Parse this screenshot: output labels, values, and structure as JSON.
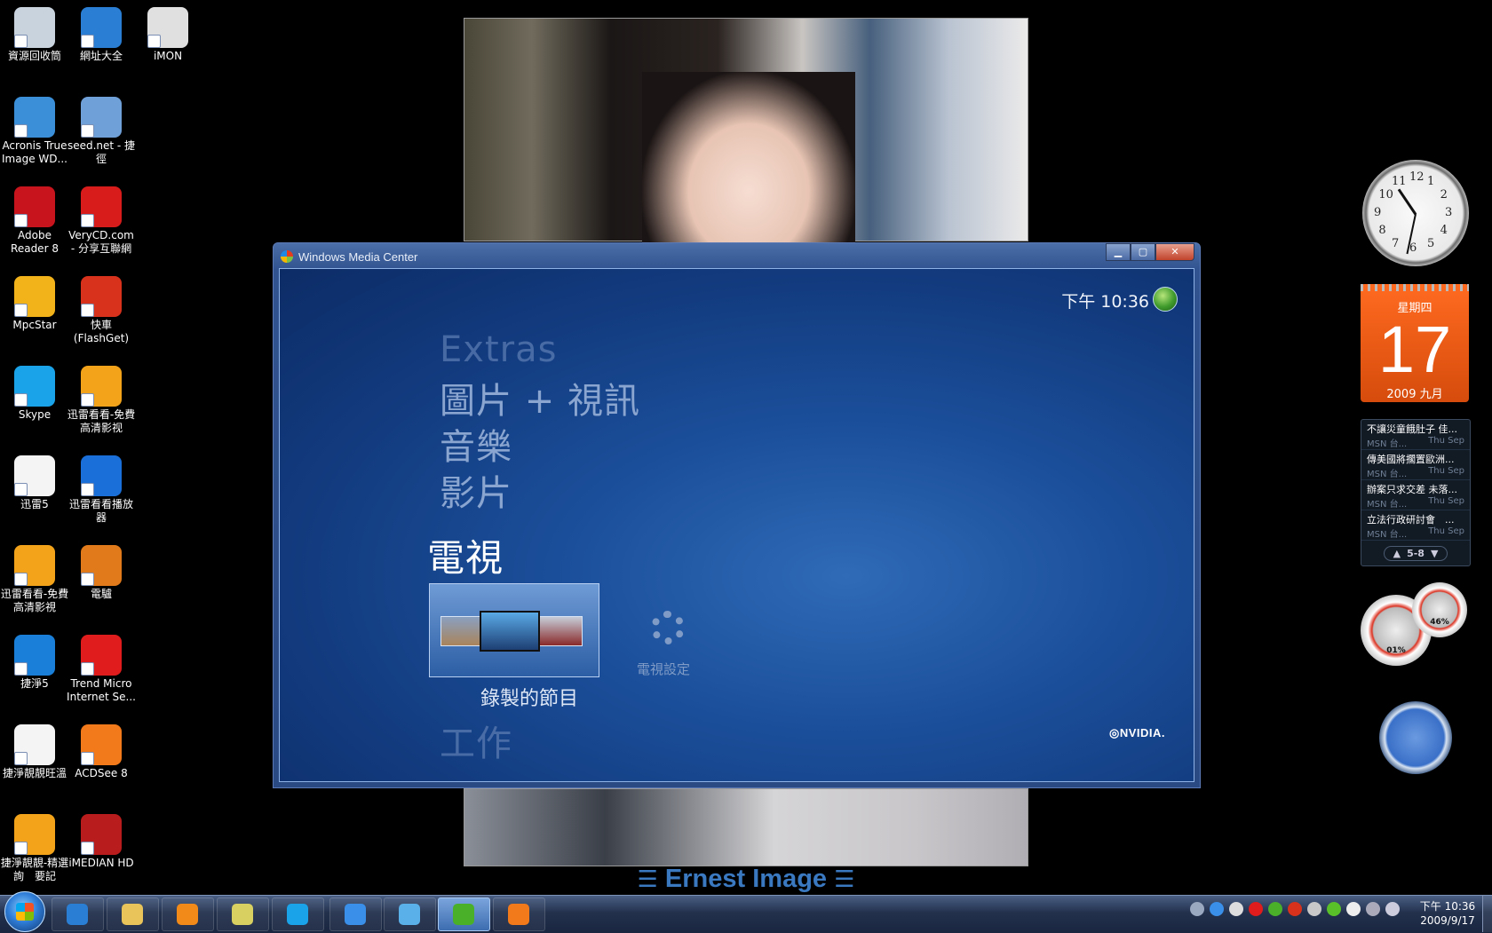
{
  "desktop": {
    "icons": [
      {
        "label": "資源回收筒",
        "name": "recycle-bin-icon",
        "color": "#c9d3de"
      },
      {
        "label": "網址大全",
        "name": "internet-explorer-icon",
        "color": "#2a7fd4"
      },
      {
        "label": "iMON",
        "name": "imon-icon",
        "color": "#e0e0e0"
      },
      {
        "label": "Acronis True Image WD...",
        "name": "acronis-icon",
        "color": "#3a8fd8"
      },
      {
        "label": "seed.net - 捷徑",
        "name": "seed-net-icon",
        "color": "#6fa0d8"
      },
      {
        "label": "Adobe Reader 8",
        "name": "adobe-reader-icon",
        "color": "#c8141c"
      },
      {
        "label": "VeryCD.com - 分享互聯網",
        "name": "verycd-icon",
        "color": "#d81c1c"
      },
      {
        "label": "MpcStar",
        "name": "mpcstar-icon",
        "color": "#f2b21a"
      },
      {
        "label": "快車 (FlashGet)",
        "name": "flashget-icon",
        "color": "#d8321c"
      },
      {
        "label": "Skype",
        "name": "skype-icon",
        "color": "#1aa3e8"
      },
      {
        "label": "迅雷看看-免費高清影视",
        "name": "xunlei-kankan-icon",
        "color": "#f2a31a"
      },
      {
        "label": "迅雷5",
        "name": "xunlei5-doc-icon",
        "color": "#f4f4f4"
      },
      {
        "label": "迅雷看看播放器",
        "name": "xunlei-player-icon",
        "color": "#1a6fd8"
      },
      {
        "label": "迅雷看看-免費高清影視",
        "name": "xunlei-kankan-2-icon",
        "color": "#f2a31a"
      },
      {
        "label": "電驢",
        "name": "emule-icon",
        "color": "#e07a1a"
      },
      {
        "label": "捷淨5",
        "name": "jiejing5-icon",
        "color": "#1a7fd8"
      },
      {
        "label": "Trend Micro Internet Se...",
        "name": "trend-micro-icon",
        "color": "#e01c1c"
      },
      {
        "label": "捷淨靚靚旺溫",
        "name": "jiejing-doc-icon",
        "color": "#f4f4f4"
      },
      {
        "label": "ACDSee 8",
        "name": "acdsee-icon",
        "color": "#f27a1a"
      },
      {
        "label": "捷淨靚靚-精選詢　要記",
        "name": "jiejing-kankan-icon",
        "color": "#f2a31a"
      },
      {
        "label": "iMEDIAN HD",
        "name": "imedian-hd-icon",
        "color": "#b81c1c"
      }
    ]
  },
  "watermark": {
    "text": "Ernest Image",
    "bars": "☰"
  },
  "media_center": {
    "title": "Windows Media Center",
    "time": "下午 10:36",
    "menu": {
      "extras": "Extras",
      "pictures_video": "圖片 + 視訊",
      "music": "音樂",
      "movies": "影片",
      "tv": "電視",
      "tasks": "工作"
    },
    "tiles": {
      "recorded": "錄製的節目",
      "tv_settings": "電視設定"
    },
    "brand": "◎NVIDIA."
  },
  "gadgets": {
    "clock": {
      "numbers": [
        "12",
        "1",
        "2",
        "3",
        "4",
        "5",
        "6",
        "7",
        "8",
        "9",
        "10",
        "11"
      ]
    },
    "calendar": {
      "weekday": "星期四",
      "day": "17",
      "year_month": "2009 九月"
    },
    "feed": {
      "items": [
        {
          "title": "不讓災童餓肚子 佳...",
          "source": "MSN 台...",
          "date": "Thu Sep"
        },
        {
          "title": "傳美國將擱置歐洲...",
          "source": "MSN 台...",
          "date": "Thu Sep"
        },
        {
          "title": "辦案只求交差 未落...",
          "source": "MSN 台...",
          "date": "Thu Sep"
        },
        {
          "title": "立法行政研討會　...",
          "source": "MSN 台...",
          "date": "Thu Sep"
        }
      ],
      "pager": "5-8",
      "prev": "▲",
      "next": "▼"
    },
    "cpu_meter": {
      "cpu": "01%",
      "mem": "46%"
    }
  },
  "taskbar": {
    "buttons": [
      {
        "name": "taskbar-ie-button",
        "color": "#2a7fd4"
      },
      {
        "name": "taskbar-explorer-button",
        "color": "#e8c45a"
      },
      {
        "name": "taskbar-media-player-button",
        "color": "#f28a1a"
      },
      {
        "name": "taskbar-folder-button",
        "color": "#d8d060"
      },
      {
        "name": "taskbar-skype-button",
        "color": "#1aa3e8"
      },
      {
        "name": "taskbar-task-button",
        "color": "#3a8fe8"
      },
      {
        "name": "taskbar-messenger-button",
        "color": "#5ab0e8"
      },
      {
        "name": "taskbar-media-center-button",
        "color": "#4ab02a"
      },
      {
        "name": "taskbar-acdsee-button",
        "color": "#f27a1a"
      }
    ],
    "clock": {
      "time": "下午 10:36",
      "date": "2009/9/17"
    }
  }
}
